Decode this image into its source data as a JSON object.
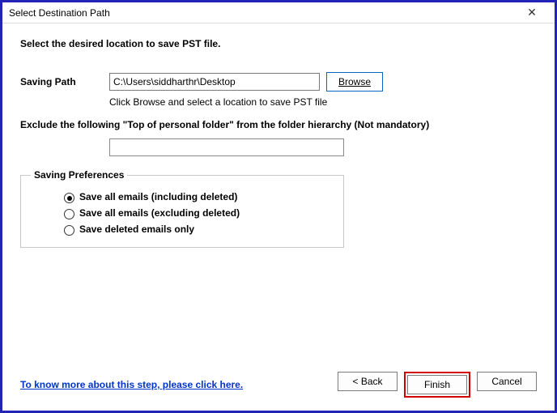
{
  "window": {
    "title": "Select Destination Path",
    "close_icon": "✕"
  },
  "main": {
    "heading": "Select the desired location to save PST file.",
    "path_label": "Saving Path",
    "path_value": "C:\\Users\\siddharthr\\Desktop",
    "browse_label": "Browse",
    "hint": "Click Browse and select a location to save PST file",
    "exclude_label": "Exclude the following \"Top of personal folder\" from the folder hierarchy  (Not mandatory)",
    "exclude_value": ""
  },
  "preferences": {
    "legend": "Saving Preferences",
    "options": [
      "Save all emails (including deleted)",
      "Save all emails (excluding deleted)",
      "Save deleted emails only"
    ],
    "selected_index": 0
  },
  "footer": {
    "help_link": "To know more about this step, please click here.",
    "back_label": "< Back",
    "finish_label": "Finish",
    "cancel_label": "Cancel"
  }
}
